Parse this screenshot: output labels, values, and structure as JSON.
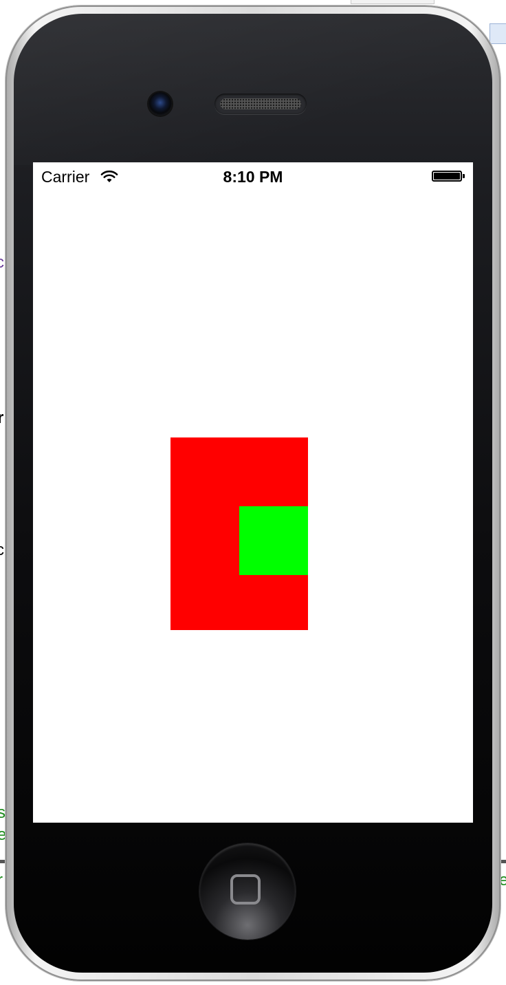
{
  "status_bar": {
    "carrier": "Carrier",
    "time": "8:10 PM",
    "wifi_icon": "wifi-icon",
    "battery_icon": "battery-icon",
    "battery_level": 1.0
  },
  "screen": {
    "background": "#ffffff",
    "red_view_color": "#ff0000",
    "green_view_color": "#00ff00"
  },
  "device": {
    "camera_icon": "camera-icon",
    "speaker_icon": "speaker-grill-icon",
    "home_button_icon": "home-button-icon"
  },
  "backdrop": {
    "left_chars": [
      "c",
      "r",
      "c",
      "s",
      "e",
      "r"
    ],
    "right_chars": [
      "e"
    ],
    "left_colors": [
      "#6a3d9a",
      "#000000",
      "#000000",
      "#1a8a1a",
      "#1a8a1a",
      "#1a8a1a"
    ],
    "right_colors": [
      "#1a8a1a"
    ]
  }
}
